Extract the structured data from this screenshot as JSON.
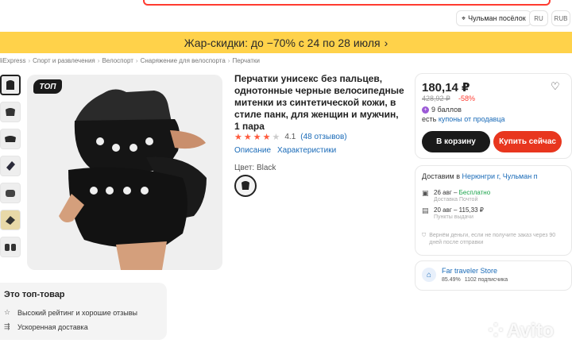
{
  "header": {
    "location_label": "Чульман посёлок",
    "lang_ru": "RU",
    "currency": "RUB"
  },
  "promo": {
    "text": "Жар-скидки: до −70% с 24 по 28 июля",
    "chevron": "›"
  },
  "breadcrumbs": [
    "liExpress",
    "Спорт и развлечения",
    "Велоспорт",
    "Снаряжение для велоспорта",
    "Перчатки"
  ],
  "gallery": {
    "badge": "ТОП",
    "thumb_count": 7
  },
  "product": {
    "title": "Перчатки унисекс без пальцев, однотонные черные велосипедные митенки из синтетической кожи, в стиле панк, для женщин и мужчин, 1 пара",
    "rating_value": "4.1",
    "rating_stars": 4,
    "reviews": "(48 отзывов)",
    "tab_description": "Описание",
    "tab_specs": "Характеристики",
    "color_label": "Цвет: Black"
  },
  "purchase": {
    "price": "180,14 ₽",
    "old_price": "428,92 ₽",
    "discount": "-58%",
    "points": "9 баллов",
    "coupon_prefix": "есть",
    "coupon_link": "купоны от продавца",
    "cart_button": "В корзину",
    "buy_button": "Купить сейчас"
  },
  "delivery": {
    "to_prefix": "Доставим в",
    "to_place": "Нерюнгри г, Чульман п",
    "options": [
      {
        "icon": "truck-icon",
        "date": "26 авг",
        "price": "Бесплатно",
        "free": true,
        "sub": "Доставка Почтой"
      },
      {
        "icon": "pickup-icon",
        "date": "20 авг",
        "price": "115,33 ₽",
        "free": false,
        "sub": "Пункты выдачи"
      }
    ],
    "refund_text": "Вернём деньги, если не получите заказ через 90 дней после отправки"
  },
  "store": {
    "name": "Far traveler Store",
    "rating": "85.49%",
    "subscribers": "1102 подписчика"
  },
  "top_product": {
    "title": "Это топ-товар",
    "items": [
      "Высокий рейтинг и хорошие отзывы",
      "Ускоренная доставка"
    ]
  },
  "watermark": "Avito",
  "colors": {
    "accent": "#ff3b30",
    "buy": "#e8361e",
    "link": "#1a6bb8",
    "promo": "#ffd24a"
  }
}
